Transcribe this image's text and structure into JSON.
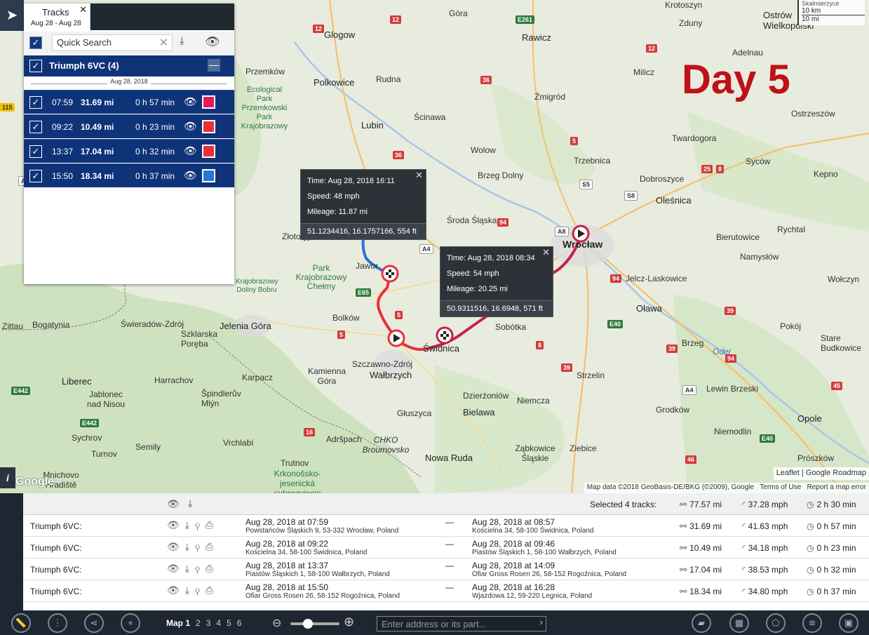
{
  "map": {
    "day_label": "Day 5",
    "scale": {
      "km": "10 km",
      "mi": "10 mi",
      "top_text": "Skalmierzyce"
    },
    "leaflet_attribution": "Leaflet | Google Roadmap",
    "attribution": {
      "data": "Map data ©2018 GeoBasis-DE/BKG (©2009), Google",
      "terms": "Terms of Use",
      "report": "Report a map error"
    },
    "google_logo": "Google",
    "info_icon": "i",
    "route_colors": {
      "red": "#e8303a",
      "crimson": "#c8204a",
      "blue": "#2b74d6"
    },
    "cities": [
      {
        "n": "Glogow"
      },
      {
        "n": "Góra"
      },
      {
        "n": "Rawicz"
      },
      {
        "n": "Krotoszyn"
      },
      {
        "n": "Zduny"
      },
      {
        "n": "Ostrów Wielkopolski"
      },
      {
        "n": "Adelnau"
      },
      {
        "n": "Przemków"
      },
      {
        "n": "Polkowice"
      },
      {
        "n": "Rudna"
      },
      {
        "n": "Milicz"
      },
      {
        "n": "Żmigród"
      },
      {
        "n": "Lubin"
      },
      {
        "n": "Ścinawa"
      },
      {
        "n": "Wolow"
      },
      {
        "n": "Trzebnica"
      },
      {
        "n": "Twardogora"
      },
      {
        "n": "Ostrzeszów"
      },
      {
        "n": "Syców"
      },
      {
        "n": "Kepno"
      },
      {
        "n": "Dobroszyce"
      },
      {
        "n": "Oleśnica"
      },
      {
        "n": "Brzeg Dolny"
      },
      {
        "n": "Środa Śląska"
      },
      {
        "n": "Złotoryja"
      },
      {
        "n": "Wrocław"
      },
      {
        "n": "Bierutowice"
      },
      {
        "n": "Rychtal"
      },
      {
        "n": "Namysłów"
      },
      {
        "n": "Wołczyn"
      },
      {
        "n": "Jelcz-Laskowice"
      },
      {
        "n": "Oława"
      },
      {
        "n": "Jawor"
      },
      {
        "n": "Bolków"
      },
      {
        "n": "Jelenia Góra"
      },
      {
        "n": "Świeradów-Zdrój"
      },
      {
        "n": "Bogatynia"
      },
      {
        "n": "Zittau"
      },
      {
        "n": "Sobótka"
      },
      {
        "n": "Świdnica"
      },
      {
        "n": "Szczawno-Zdrój"
      },
      {
        "n": "Wałbrzych"
      },
      {
        "n": "Strzelin"
      },
      {
        "n": "Brzeg"
      },
      {
        "n": "Oder"
      },
      {
        "n": "Pokój"
      },
      {
        "n": "Stare Budkowice"
      },
      {
        "n": "Lewin Brzeski"
      },
      {
        "n": "Opole"
      },
      {
        "n": "Niemodlin"
      },
      {
        "n": "Prószków"
      },
      {
        "n": "Grodków"
      },
      {
        "n": "Ziebice"
      },
      {
        "n": "Ząbkowice Śląskie"
      },
      {
        "n": "Niemcza"
      },
      {
        "n": "Dzierżoniów"
      },
      {
        "n": "Bielawa"
      },
      {
        "n": "Nowa Ruda"
      },
      {
        "n": "Głuszyca"
      },
      {
        "n": "Kamienna Góra"
      },
      {
        "n": "Karpacz"
      },
      {
        "n": "Szklarska Poręba"
      },
      {
        "n": "Harrachov"
      },
      {
        "n": "Špindlerův Mlýn"
      },
      {
        "n": "Liberec"
      },
      {
        "n": "Jablonec nad Nisou"
      },
      {
        "n": "Sychrov"
      },
      {
        "n": "Semily"
      },
      {
        "n": "Turnov"
      },
      {
        "n": "Vrchlabí"
      },
      {
        "n": "Adršpach"
      },
      {
        "n": "CHKO Broumovsko"
      },
      {
        "n": "Trutnov"
      },
      {
        "n": "Krkonošsko-jesenická subprovincie"
      },
      {
        "n": "Mnichovo Hradiště"
      },
      {
        "n": "Park Krajobrazowy Chełmy"
      },
      {
        "n": "Ecological Park Przemkowski Park Krajobrazowy"
      },
      {
        "n": "Krajobrazowy Doliny Bobru"
      }
    ],
    "popups": [
      {
        "time": "Time: Aug 28, 2018 16:11",
        "speed": "Speed: 48 mph",
        "mileage": "Mileage: 11.87 mi",
        "coords": "51.1234416, 16.1757166, 554 ft"
      },
      {
        "time": "Time: Aug 28, 2018 08:34",
        "speed": "Speed: 54 mph",
        "mileage": "Mileage: 20.25 mi",
        "coords": "50.9311516, 16.6948, 571 ft"
      }
    ]
  },
  "tracks_panel": {
    "tab_title": "Tracks",
    "tab_dates": "Aug 28 - Aug 28",
    "search_placeholder": "Quick Search",
    "group_label": "Triumph 6VC (4)",
    "date_divider": "Aug 28, 2018",
    "tracks": [
      {
        "time": "07:59",
        "distance": "31.69 mi",
        "duration": "0 h 57 min",
        "color": "#e3195a"
      },
      {
        "time": "09:22",
        "distance": "10.49 mi",
        "duration": "0 h 23 min",
        "color": "#e8303a"
      },
      {
        "time": "13:37",
        "distance": "17.04 mi",
        "duration": "0 h 32 min",
        "color": "#e8303a"
      },
      {
        "time": "15:50",
        "distance": "18.34 mi",
        "duration": "0 h 37 min",
        "color": "#2b74d6"
      }
    ]
  },
  "bottom": {
    "selected_label": "Selected 4 tracks:",
    "totals": {
      "distance": "77.57 mi",
      "speed": "37.28 mph",
      "duration": "2 h 30 min"
    },
    "rows": [
      {
        "name": "Triumph 6VC:",
        "start_date": "Aug 28, 2018 at 07:59",
        "start_addr": "Powstańców Śląskich 9, 53-332 Wrocław, Poland",
        "dash": "—",
        "end_date": "Aug 28, 2018 at 08:57",
        "end_addr": "Kościelna 34, 58-100 Świdnica, Poland",
        "distance": "31.69 mi",
        "speed": "41.63 mph",
        "duration": "0 h 57 min"
      },
      {
        "name": "Triumph 6VC:",
        "start_date": "Aug 28, 2018 at 09:22",
        "start_addr": "Kościelna 34, 58-100 Świdnica, Poland",
        "dash": "—",
        "end_date": "Aug 28, 2018 at 09:46",
        "end_addr": "Piastów Śląskich 1, 58-100 Wałbrzych, Poland",
        "distance": "10.49 mi",
        "speed": "34.18 mph",
        "duration": "0 h 23 min"
      },
      {
        "name": "Triumph 6VC:",
        "start_date": "Aug 28, 2018 at 13:37",
        "start_addr": "Piastów Śląskich 1, 58-100 Wałbrzych, Poland",
        "dash": "—",
        "end_date": "Aug 28, 2018 at 14:09",
        "end_addr": "Ofiar Gross Rosen 26, 58-152 Rogoźnica, Poland",
        "distance": "17.04 mi",
        "speed": "38.53 mph",
        "duration": "0 h 32 min"
      },
      {
        "name": "Triumph 6VC:",
        "start_date": "Aug 28, 2018 at 15:50",
        "start_addr": "Ofiar Gross Rosen 26, 58-152 Rogoźnica, Poland",
        "dash": "—",
        "end_date": "Aug 28, 2018 at 16:28",
        "end_addr": "Wjazdowa 12, 59-220 Legnica, Poland",
        "distance": "18.34 mi",
        "speed": "34.80 mph",
        "duration": "0 h 37 min"
      }
    ]
  },
  "footer": {
    "maps": [
      "Map 1",
      "2",
      "3",
      "4",
      "5",
      "6"
    ],
    "address_placeholder": "Enter address or its part..."
  }
}
